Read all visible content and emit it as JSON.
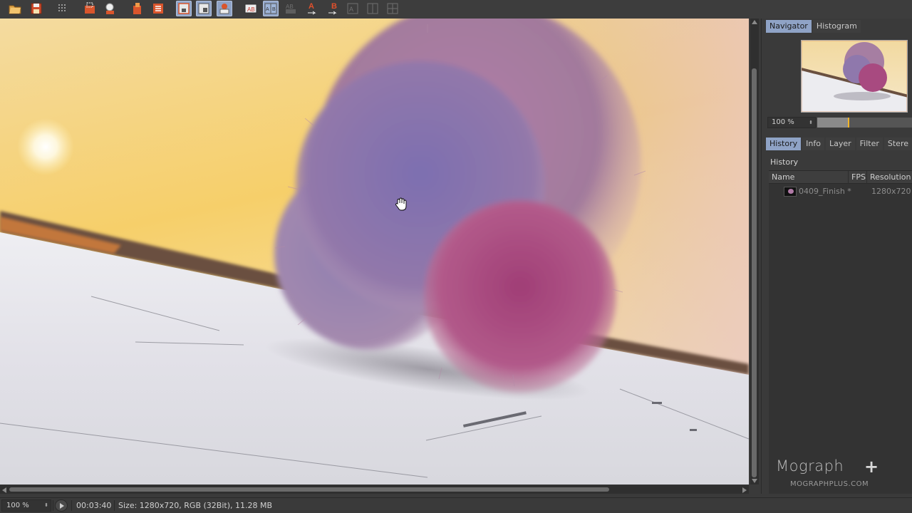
{
  "toolbar": {
    "buttons": [
      {
        "icon": "open-folder-icon",
        "state": "normal"
      },
      {
        "icon": "save-icon",
        "state": "normal"
      },
      {
        "icon": "grid-dots-icon",
        "state": "normal"
      },
      {
        "icon": "region-select-icon",
        "state": "normal"
      },
      {
        "icon": "magnifier-icon",
        "state": "normal"
      },
      {
        "icon": "copy-layer-icon",
        "state": "normal"
      },
      {
        "icon": "layer-list-icon",
        "state": "normal"
      },
      {
        "icon": "frame-view-icon",
        "state": "active"
      },
      {
        "icon": "frame-view-alt-icon",
        "state": "active"
      },
      {
        "icon": "filter-icon",
        "state": "active"
      },
      {
        "icon": "ab-compare-icon",
        "state": "normal"
      },
      {
        "icon": "ab-split-icon",
        "state": "active"
      },
      {
        "icon": "ab-swap-icon",
        "state": "disabled"
      },
      {
        "icon": "a-marker-icon",
        "state": "normal"
      },
      {
        "icon": "b-marker-icon",
        "state": "normal"
      },
      {
        "icon": "compare-left-icon",
        "state": "disabled"
      },
      {
        "icon": "compare-right-icon",
        "state": "disabled"
      },
      {
        "icon": "compare-grid-icon",
        "state": "disabled"
      }
    ]
  },
  "navigator_panel": {
    "tabs": [
      "Navigator",
      "Histogram"
    ],
    "active_tab": "Navigator",
    "zoom_value": "100 %",
    "zoom_level_fraction": 0.33
  },
  "history_panel": {
    "tabs": [
      "History",
      "Info",
      "Layer",
      "Filter",
      "Stere"
    ],
    "active_tab": "History",
    "title": "History",
    "columns": {
      "name": "Name",
      "fps": "FPS",
      "resolution": "Resolution"
    },
    "rows": [
      {
        "name": "0409_Finish *",
        "fps": "",
        "resolution": "1280x720"
      }
    ]
  },
  "watermark": {
    "brand": "Mograph",
    "plus": "+",
    "url": "MOGRAPHPLUS.COM"
  },
  "statusbar": {
    "zoom": "100 %",
    "time": "00:03:40",
    "info": "Size: 1280x720, RGB (32Bit), 11.28 MB"
  },
  "colors": {
    "accent_tab": "#8fa3c6",
    "panel_bg": "#3a3a3a",
    "zoom_knob": "#f0b429"
  }
}
